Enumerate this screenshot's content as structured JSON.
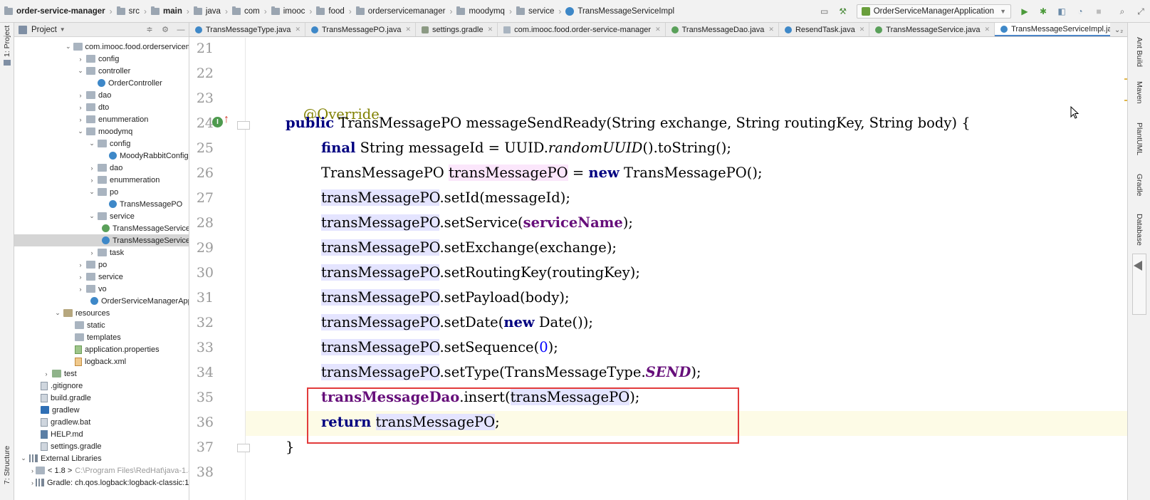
{
  "breadcrumb": [
    {
      "label": "order-service-manager",
      "icon": "folder-icon",
      "bold": true
    },
    {
      "label": "src",
      "icon": "folder-icon",
      "bold": false
    },
    {
      "label": "main",
      "icon": "folder-icon",
      "bold": true
    },
    {
      "label": "java",
      "icon": "folder-icon",
      "bold": false
    },
    {
      "label": "com",
      "icon": "folder-icon",
      "bold": false
    },
    {
      "label": "imooc",
      "icon": "folder-icon",
      "bold": false
    },
    {
      "label": "food",
      "icon": "folder-icon",
      "bold": false
    },
    {
      "label": "orderservicemanager",
      "icon": "folder-icon",
      "bold": false
    },
    {
      "label": "moodymq",
      "icon": "folder-icon",
      "bold": false
    },
    {
      "label": "service",
      "icon": "folder-icon",
      "bold": false
    },
    {
      "label": "TransMessageServiceImpl",
      "icon": "class-icon",
      "bold": false
    }
  ],
  "run_config": {
    "label": "OrderServiceManagerApplication"
  },
  "project_panel": {
    "title": "Project"
  },
  "tree": [
    {
      "label": "com.imooc.food.orderservicem",
      "indent": 4,
      "arrow": "down",
      "icon": "folder"
    },
    {
      "label": "config",
      "indent": 5,
      "arrow": "right",
      "icon": "folder"
    },
    {
      "label": "controller",
      "indent": 5,
      "arrow": "down",
      "icon": "folder"
    },
    {
      "label": "OrderController",
      "indent": 6,
      "arrow": "",
      "icon": "class"
    },
    {
      "label": "dao",
      "indent": 5,
      "arrow": "right",
      "icon": "folder"
    },
    {
      "label": "dto",
      "indent": 5,
      "arrow": "right",
      "icon": "folder"
    },
    {
      "label": "enummeration",
      "indent": 5,
      "arrow": "right",
      "icon": "folder"
    },
    {
      "label": "moodymq",
      "indent": 5,
      "arrow": "down",
      "icon": "folder"
    },
    {
      "label": "config",
      "indent": 6,
      "arrow": "down",
      "icon": "folder"
    },
    {
      "label": "MoodyRabbitConfig",
      "indent": 7,
      "arrow": "",
      "icon": "class"
    },
    {
      "label": "dao",
      "indent": 6,
      "arrow": "right",
      "icon": "folder"
    },
    {
      "label": "enummeration",
      "indent": 6,
      "arrow": "right",
      "icon": "folder"
    },
    {
      "label": "po",
      "indent": 6,
      "arrow": "down",
      "icon": "folder"
    },
    {
      "label": "TransMessagePO",
      "indent": 7,
      "arrow": "",
      "icon": "class"
    },
    {
      "label": "service",
      "indent": 6,
      "arrow": "down",
      "icon": "folder"
    },
    {
      "label": "TransMessageService",
      "indent": 7,
      "arrow": "",
      "icon": "iface"
    },
    {
      "label": "TransMessageService",
      "indent": 7,
      "arrow": "",
      "icon": "class",
      "selected": true
    },
    {
      "label": "task",
      "indent": 6,
      "arrow": "right",
      "icon": "folder"
    },
    {
      "label": "po",
      "indent": 5,
      "arrow": "right",
      "icon": "folder"
    },
    {
      "label": "service",
      "indent": 5,
      "arrow": "right",
      "icon": "folder"
    },
    {
      "label": "vo",
      "indent": 5,
      "arrow": "right",
      "icon": "folder"
    },
    {
      "label": "OrderServiceManagerApplic",
      "indent": 6,
      "arrow": "",
      "icon": "class"
    },
    {
      "label": "resources",
      "indent": 3,
      "arrow": "down",
      "icon": "folder-res"
    },
    {
      "label": "static",
      "indent": 4,
      "arrow": "",
      "icon": "folder"
    },
    {
      "label": "templates",
      "indent": 4,
      "arrow": "",
      "icon": "folder"
    },
    {
      "label": "application.properties",
      "indent": 4,
      "arrow": "",
      "icon": "props"
    },
    {
      "label": "logback.xml",
      "indent": 4,
      "arrow": "",
      "icon": "xml"
    },
    {
      "label": "test",
      "indent": 2,
      "arrow": "right",
      "icon": "folder-test"
    },
    {
      "label": ".gitignore",
      "indent": 1,
      "arrow": "",
      "icon": "file"
    },
    {
      "label": "build.gradle",
      "indent": 1,
      "arrow": "",
      "icon": "file"
    },
    {
      "label": "gradlew",
      "indent": 1,
      "arrow": "",
      "icon": "shell"
    },
    {
      "label": "gradlew.bat",
      "indent": 1,
      "arrow": "",
      "icon": "file"
    },
    {
      "label": "HELP.md",
      "indent": 1,
      "arrow": "",
      "icon": "md"
    },
    {
      "label": "settings.gradle",
      "indent": 1,
      "arrow": "",
      "icon": "file"
    },
    {
      "label": "External Libraries",
      "indent": 0,
      "arrow": "down",
      "icon": "lib"
    },
    {
      "label": "< 1.8 >",
      "indent": 1,
      "arrow": "right",
      "icon": "folder",
      "dim": "C:\\Program Files\\RedHat\\java-1.8"
    },
    {
      "label": "Gradle: ch.qos.logback:logback-classic:1.2",
      "indent": 1,
      "arrow": "right",
      "icon": "lib"
    }
  ],
  "tabs": [
    {
      "label": "TransMessageType.java",
      "icon": "c",
      "active": false
    },
    {
      "label": "TransMessagePO.java",
      "icon": "c",
      "active": false
    },
    {
      "label": "settings.gradle",
      "icon": "g",
      "active": false
    },
    {
      "label": "com.imooc.food.order-service-manager",
      "icon": "f",
      "active": false
    },
    {
      "label": "TransMessageDao.java",
      "icon": "i",
      "active": false
    },
    {
      "label": "ResendTask.java",
      "icon": "c",
      "active": false
    },
    {
      "label": "TransMessageService.java",
      "icon": "i",
      "active": false
    },
    {
      "label": "TransMessageServiceImpl.java",
      "icon": "c",
      "active": true
    }
  ],
  "line_numbers": [
    "21",
    "22",
    "23",
    "24",
    "25",
    "26",
    "27",
    "28",
    "29",
    "30",
    "31",
    "32",
    "33",
    "34",
    "35",
    "36",
    "37",
    "38"
  ],
  "code": {
    "override": "@Override",
    "l24_public": "public",
    "l24_rest": " TransMessagePO messageSendReady(String exchange, String routingKey, String body) {",
    "l25_final": "final",
    "l25_a": " String messageId = UUID.",
    "l25_ital": "randomUUID",
    "l25_b": "().toString();",
    "l26_a": "TransMessagePO ",
    "l26_var": "transMessagePO",
    "l26_b": " = ",
    "l26_new": "new",
    "l26_c": " TransMessagePO();",
    "var": "transMessagePO",
    "l27": ".setId(messageId);",
    "l28_a": ".setService(",
    "l28_field": "serviceName",
    "l28_b": ");",
    "l29": ".setExchange(exchange);",
    "l30": ".setRoutingKey(routingKey);",
    "l31": ".setPayload(body);",
    "l32_a": ".setDate(",
    "l32_new": "new",
    "l32_b": " Date());",
    "l33_a": ".setSequence(",
    "l33_num": "0",
    "l33_b": ");",
    "l34_a": ".setType(TransMessageType.",
    "l34_const": "SEND",
    "l34_b": ");",
    "l35_field": "transMessageDao",
    "l35_a": ".insert(",
    "l35_b": ");",
    "l36_return": "return",
    "l36_b": ";",
    "l37": "}"
  },
  "right_stripe": [
    "Ant Build",
    "Maven",
    "PlantUML",
    "Gradle",
    "Database"
  ],
  "left_stripe": [
    "1: Project",
    "7: Structure"
  ],
  "colors": {
    "keyword": "#000080",
    "annotation": "#808000",
    "field": "#660e7a",
    "number": "#0000ff",
    "highlight_box": "#e23b3b"
  }
}
